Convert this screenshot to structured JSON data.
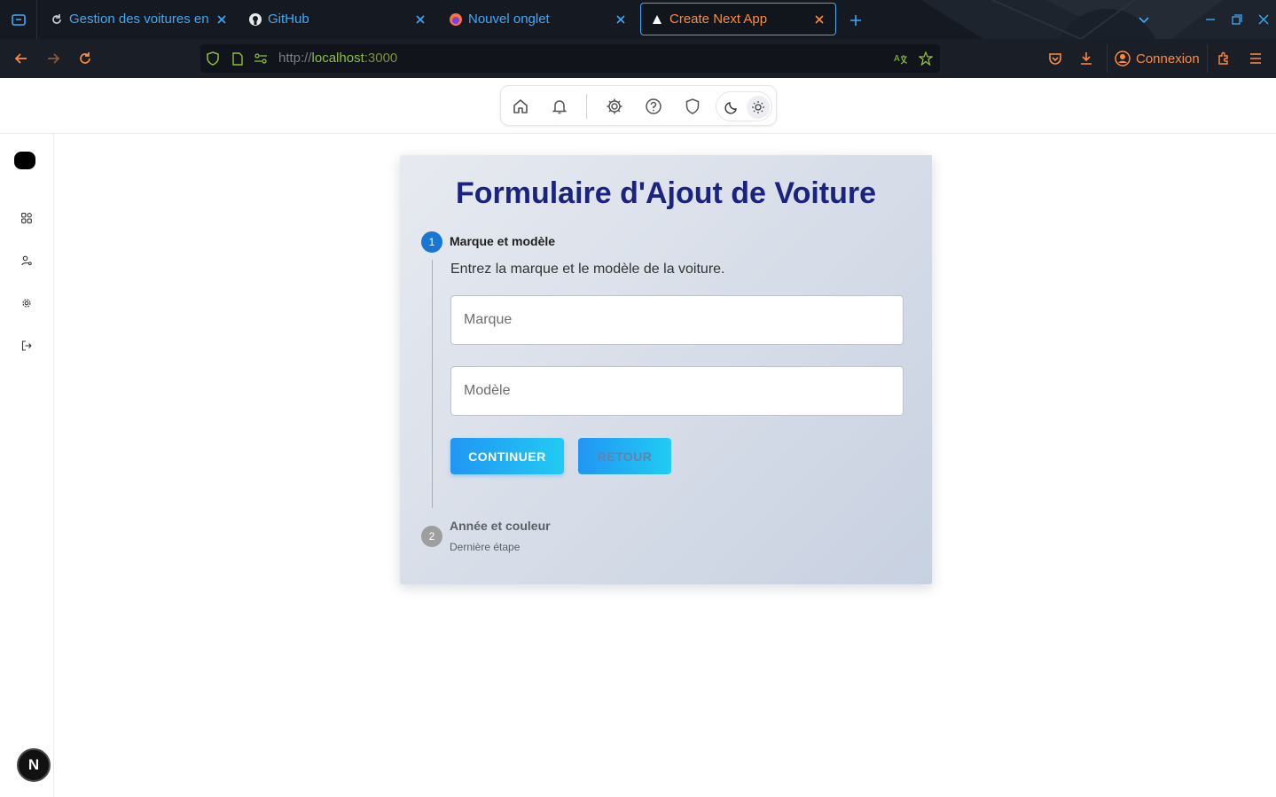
{
  "browser": {
    "tabs": [
      {
        "label": "Gestion des voitures en",
        "icon": "refresh-icon",
        "active": false
      },
      {
        "label": "GitHub",
        "icon": "github-icon",
        "active": false
      },
      {
        "label": "Nouvel onglet",
        "icon": "firefox-icon",
        "active": false
      },
      {
        "label": "Create Next App",
        "icon": "nextjs-triangle-icon",
        "active": true
      }
    ],
    "url": {
      "scheme": "http://",
      "host": "localhost",
      "port": ":3000"
    },
    "connexion_label": "Connexion",
    "colors": {
      "accent": "#3fa9f5",
      "highlight": "#ff8a3d",
      "titlebar": "#151a22"
    }
  },
  "toolbar": {
    "icons": [
      "home-icon",
      "bell-icon",
      "gear-icon",
      "help-icon",
      "shield-icon",
      "moon-icon",
      "sun-icon"
    ]
  },
  "sidebar": {
    "items": [
      "dashboard-icon",
      "user-settings-icon",
      "settings-icon",
      "logout-icon"
    ],
    "avatar_letter": "N"
  },
  "form": {
    "title": "Formulaire d'Ajout de Voiture",
    "steps": [
      {
        "number": "1",
        "title": "Marque et modèle",
        "description": "Entrez la marque et le modèle de la voiture.",
        "active": true
      },
      {
        "number": "2",
        "title": "Année et couleur",
        "subtitle": "Dernière étape",
        "active": false
      }
    ],
    "fields": {
      "marque_placeholder": "Marque",
      "modele_placeholder": "Modèle"
    },
    "buttons": {
      "continue": "CONTINUER",
      "back": "RETOUR"
    },
    "colors": {
      "title": "#1a237e",
      "step_active": "#1976d2",
      "step_inactive": "#9e9e9e",
      "button_from": "#2196f3",
      "button_to": "#21cbf3"
    }
  }
}
